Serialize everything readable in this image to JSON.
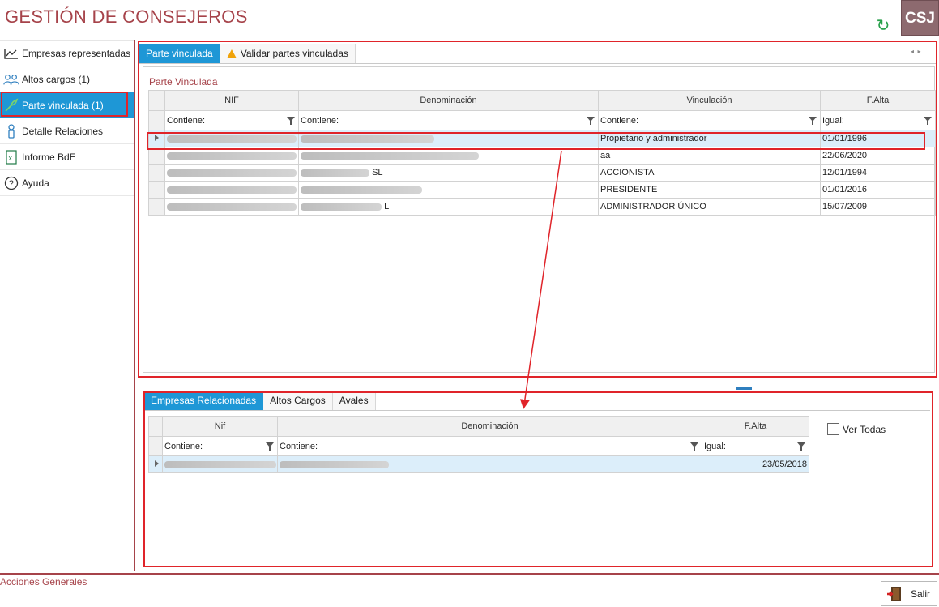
{
  "app": {
    "title": "GESTIÓN DE CONSEJEROS",
    "logo_text": "CSJ"
  },
  "sidebar": {
    "items": [
      {
        "label": "Empresas representadas",
        "icon": "chart-icon"
      },
      {
        "label": "Altos cargos (1)",
        "icon": "users-icon"
      },
      {
        "label": "Parte vinculada (1)",
        "icon": "link-icon"
      },
      {
        "label": "Detalle Relaciones",
        "icon": "person-icon"
      },
      {
        "label": "Informe BdE",
        "icon": "excel-icon"
      },
      {
        "label": "Ayuda",
        "icon": "help-icon"
      }
    ]
  },
  "top_tabs": [
    {
      "label": "Parte vinculada"
    },
    {
      "label": "Validar partes vinculadas"
    }
  ],
  "top_panel": {
    "section_label": "Parte Vinculada",
    "columns": [
      "NIF",
      "Denominación",
      "Vinculación",
      "F.Alta"
    ],
    "filters": [
      "Contiene:",
      "Contiene:",
      "Contiene:",
      "Igual:"
    ],
    "rows": [
      {
        "nif": "",
        "denominacion": "",
        "vinculacion": "Propietario y administrador",
        "falta": "01/01/1996"
      },
      {
        "nif": "",
        "denominacion": "",
        "vinculacion": "aa",
        "falta": "22/06/2020"
      },
      {
        "nif": "",
        "denominacion": "SL",
        "vinculacion": "ACCIONISTA",
        "falta": "12/01/1994"
      },
      {
        "nif": "",
        "denominacion": "",
        "vinculacion": "PRESIDENTE",
        "falta": "01/01/2016"
      },
      {
        "nif": "",
        "denominacion": "L",
        "vinculacion": "ADMINISTRADOR ÚNICO",
        "falta": "15/07/2009"
      }
    ]
  },
  "bottom_tabs": [
    {
      "label": "Empresas Relacionadas"
    },
    {
      "label": "Altos Cargos"
    },
    {
      "label": "Avales"
    }
  ],
  "bottom_panel": {
    "columns": [
      "Nif",
      "Denominación",
      "F.Alta"
    ],
    "filters": [
      "Contiene:",
      "Contiene:",
      "Igual:"
    ],
    "rows": [
      {
        "nif": "",
        "denominacion": "",
        "falta": "23/05/2018"
      }
    ],
    "ver_todas_label": "Ver Todas"
  },
  "footer": {
    "acciones_label": "Acciones Generales",
    "salir_label": "Salir"
  },
  "colors": {
    "accent": "#a6434a",
    "selected_tab": "#1e97d6",
    "annotation_red": "#e0242a"
  }
}
